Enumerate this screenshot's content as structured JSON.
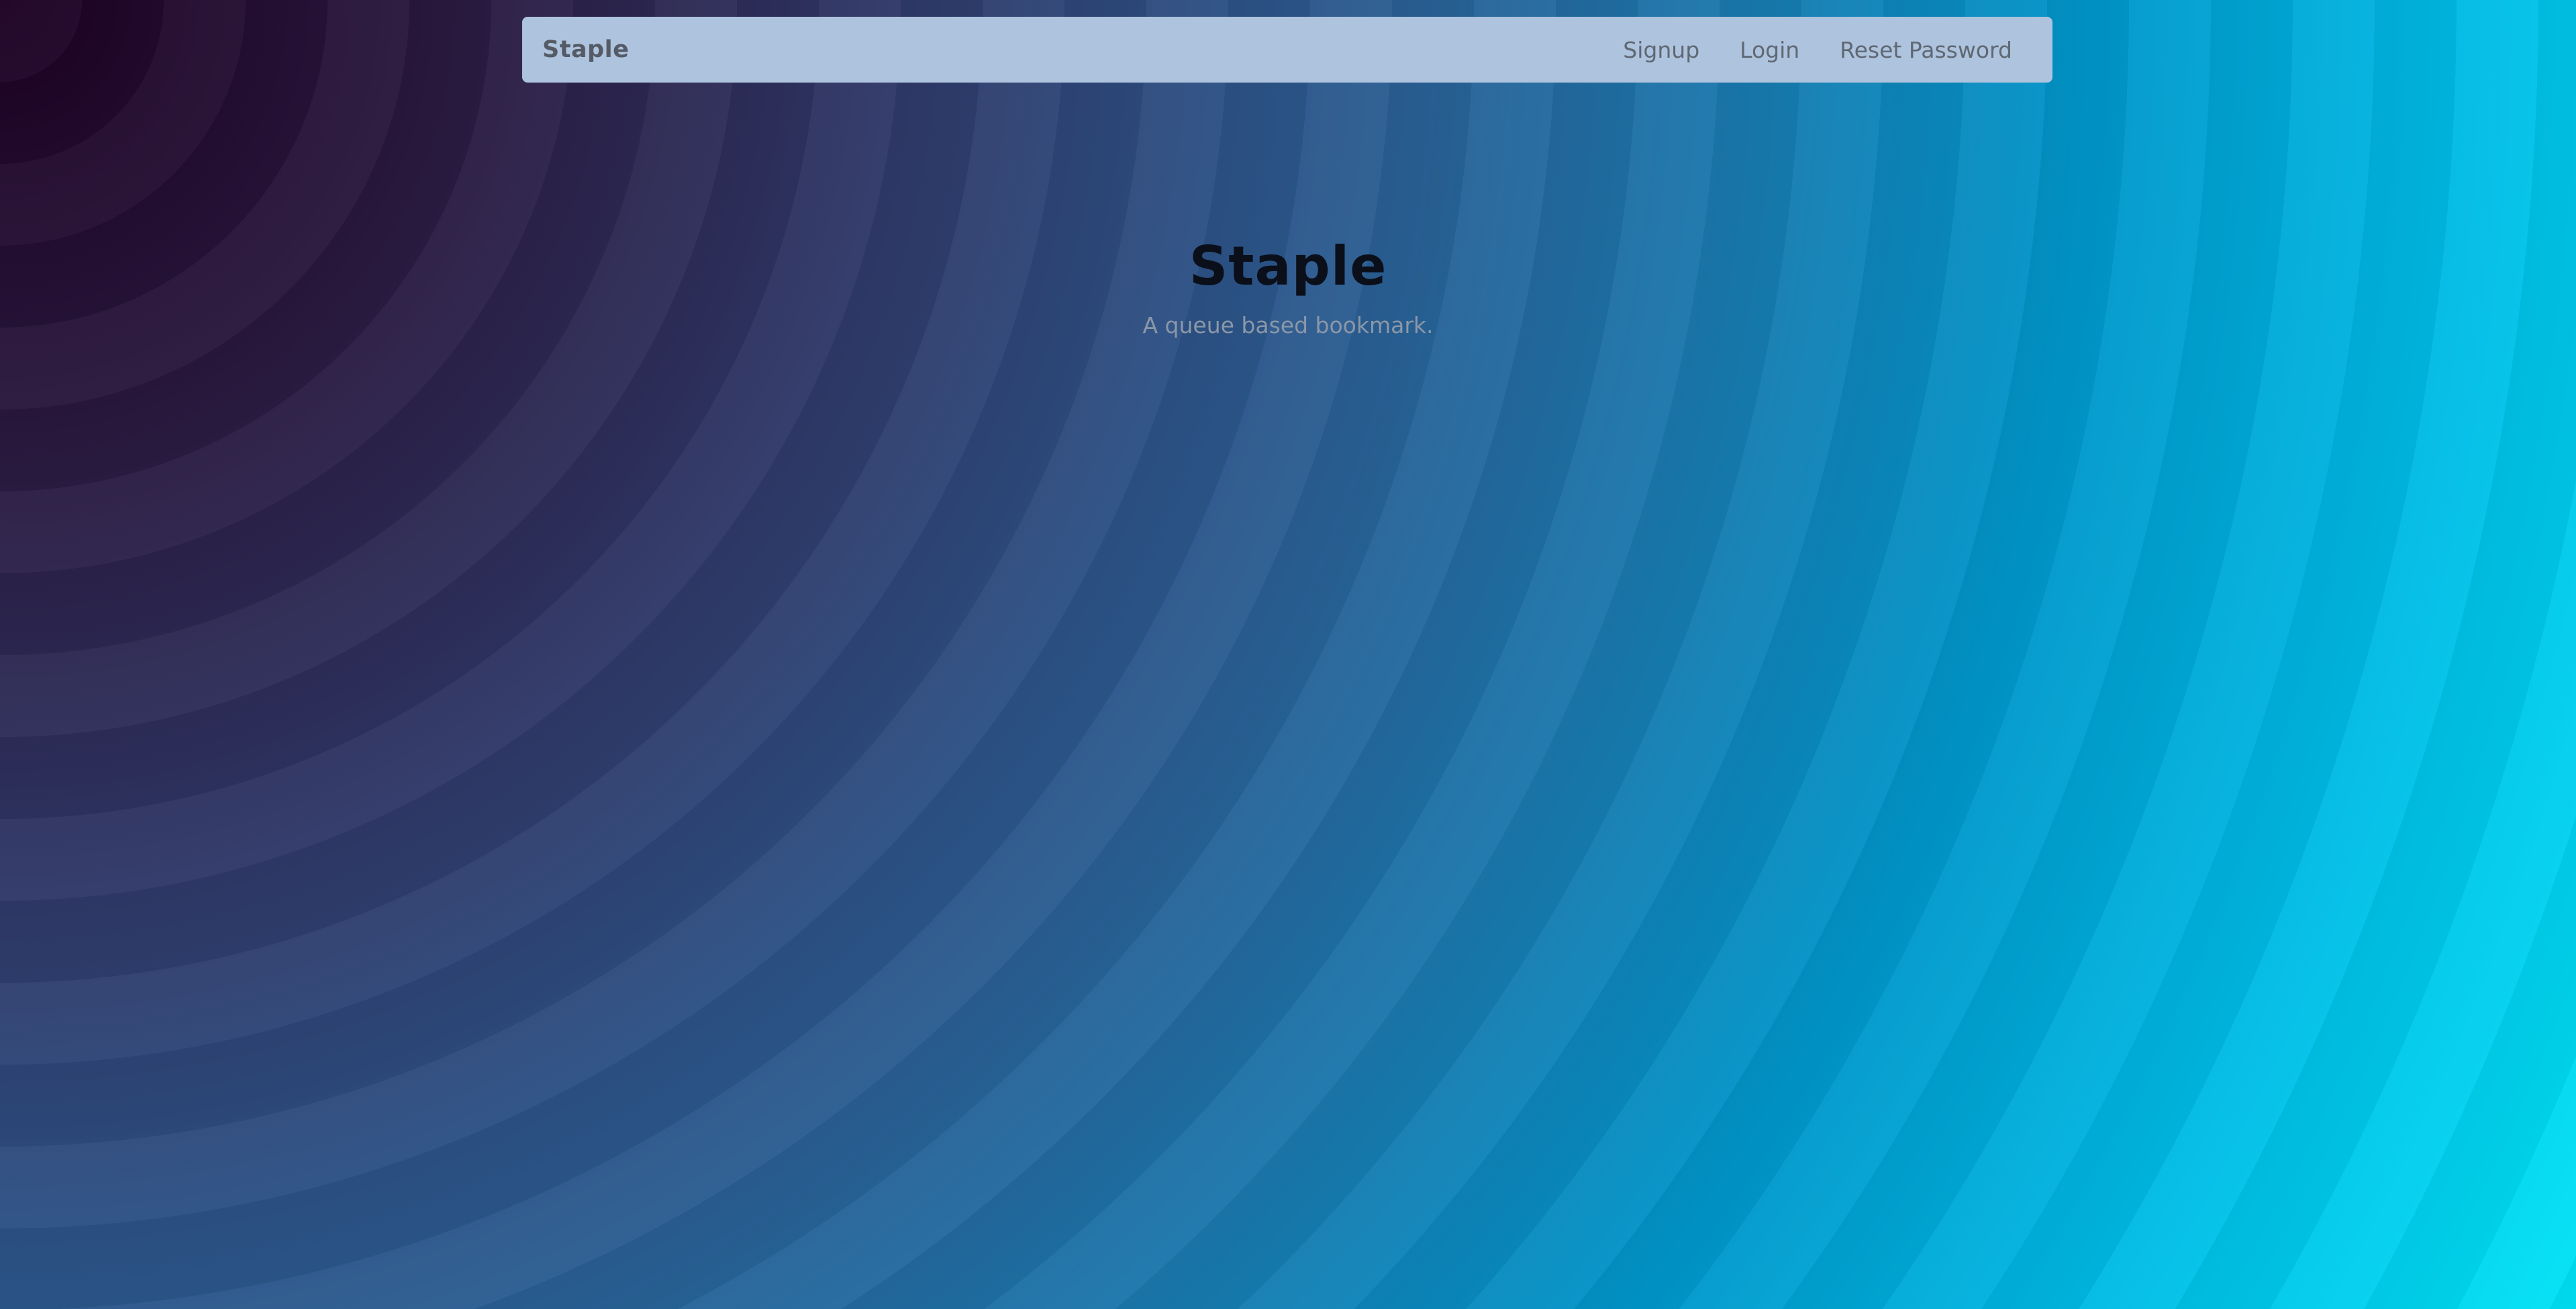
{
  "navbar": {
    "brand": "Staple",
    "links": [
      {
        "label": "Signup"
      },
      {
        "label": "Login"
      },
      {
        "label": "Reset Password"
      }
    ]
  },
  "hero": {
    "title": "Staple",
    "subtitle": "A queue based bookmark."
  },
  "colors": {
    "navbar_background": "#aec3dd",
    "background_dark": "#1c0022",
    "background_mid": "#2b5d92",
    "background_light": "#00e2f6"
  }
}
